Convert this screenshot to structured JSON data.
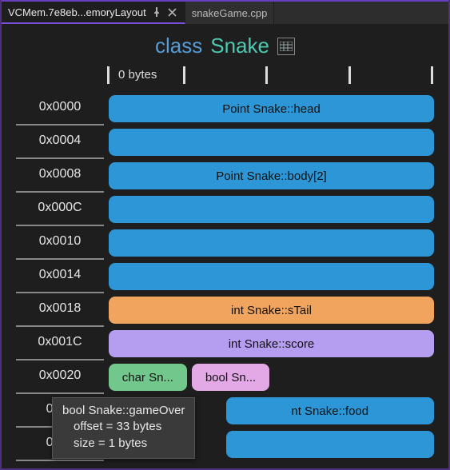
{
  "tabs": [
    {
      "label": "VCMem.7e8eb...emoryLayout"
    },
    {
      "label": "snakeGame.cpp"
    }
  ],
  "title": {
    "keyword": "class",
    "class_name": "Snake"
  },
  "ruler": {
    "zero_label": "0 bytes"
  },
  "colors": {
    "blue": "#2d96d6",
    "orange": "#f0a45e",
    "purple": "#b59df0",
    "green": "#71c78c",
    "pink": "#e3a8e6"
  },
  "rows": [
    {
      "offset": "0x0000",
      "blocks": [
        {
          "text": "Point Snake::head",
          "color": "blue",
          "name": "member-head"
        }
      ]
    },
    {
      "offset": "0x0004",
      "blocks": [
        {
          "text": "",
          "color": "blue",
          "name": "member-head-cont"
        }
      ]
    },
    {
      "offset": "0x0008",
      "blocks": [
        {
          "text": "Point Snake::body[2]",
          "color": "blue",
          "name": "member-body"
        }
      ]
    },
    {
      "offset": "0x000C",
      "blocks": [
        {
          "text": "",
          "color": "blue",
          "name": "member-body-cont-1"
        }
      ]
    },
    {
      "offset": "0x0010",
      "blocks": [
        {
          "text": "",
          "color": "blue",
          "name": "member-body-cont-2"
        }
      ]
    },
    {
      "offset": "0x0014",
      "blocks": [
        {
          "text": "",
          "color": "blue",
          "name": "member-body-cont-3"
        }
      ]
    },
    {
      "offset": "0x0018",
      "blocks": [
        {
          "text": "int Snake::sTail",
          "color": "orange",
          "name": "member-stail"
        }
      ]
    },
    {
      "offset": "0x001C",
      "blocks": [
        {
          "text": "int Snake::score",
          "color": "purple",
          "name": "member-score"
        }
      ]
    },
    {
      "offset": "0x0020",
      "partial": true,
      "blocks": [
        {
          "text": "char Sn...",
          "color": "green",
          "width": "24%",
          "name": "member-char"
        },
        {
          "text": "bool Sn...",
          "color": "pink",
          "width": "24%",
          "name": "member-gameover"
        }
      ]
    },
    {
      "offset": "0x00",
      "overlay": true,
      "blocks": [
        {
          "text": "nt Snake::food",
          "color": "blue",
          "name": "member-food",
          "leftpad": "36%"
        }
      ]
    },
    {
      "offset": "0x00",
      "overlay": true,
      "blocks": [
        {
          "text": "",
          "color": "blue",
          "name": "member-food-cont",
          "leftpad": "36%"
        }
      ]
    }
  ],
  "tooltip": {
    "title": "bool Snake::gameOver",
    "offset_line": "offset = 33 bytes",
    "size_line": "size = 1 bytes"
  }
}
